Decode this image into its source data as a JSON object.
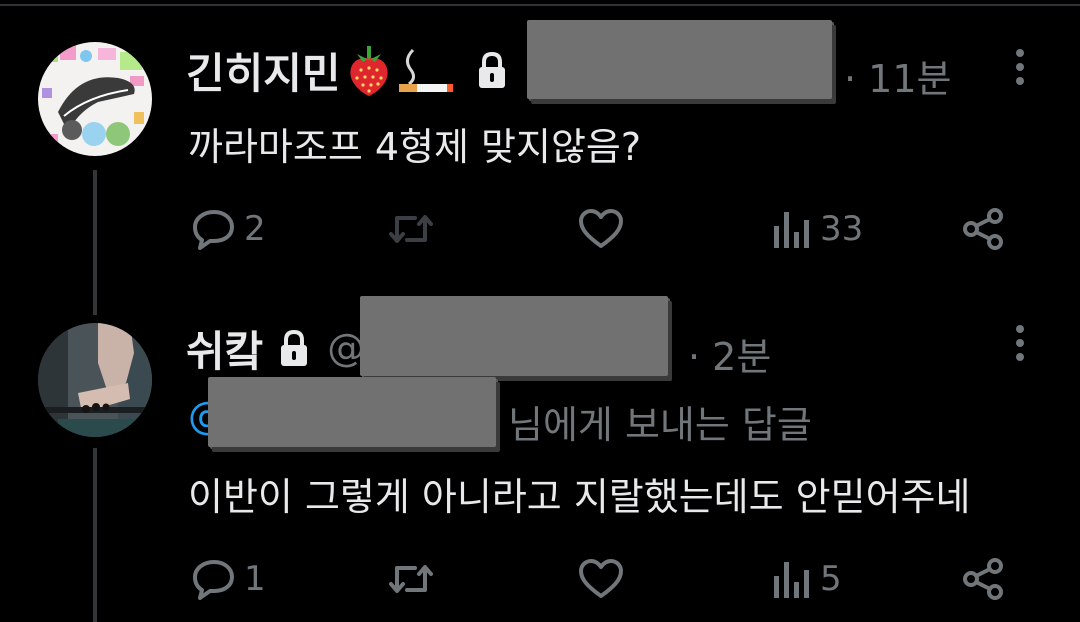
{
  "tweets": [
    {
      "display_name": "긴히지민",
      "handle": "",
      "time": "· 11분",
      "text": "까라마조프 4형제 맞지않음?",
      "reply_to_suffix": "",
      "actions": {
        "reply_count": "2",
        "retweet_count": "",
        "like_count": "",
        "views_count": "33"
      }
    },
    {
      "display_name": "쉬캌",
      "handle": "@",
      "time": "· 2분",
      "reply_to_prefix": "@",
      "reply_to_suffix": "님에게 보내는 답글",
      "text": "이반이 그렇게 아니라고 지랄했는데도 안믿어주네",
      "actions": {
        "reply_count": "1",
        "retweet_count": "",
        "like_count": "",
        "views_count": "5"
      }
    }
  ],
  "colors": {
    "background": "#000000",
    "text_primary": "#e7e9ea",
    "text_secondary": "#71767b",
    "link": "#1d9bf0",
    "redaction": "#717171"
  },
  "icons": [
    "lock-icon",
    "strawberry-emoji",
    "cigarette-emoji",
    "more-icon",
    "reply-icon",
    "retweet-icon",
    "like-icon",
    "views-icon",
    "share-icon"
  ]
}
